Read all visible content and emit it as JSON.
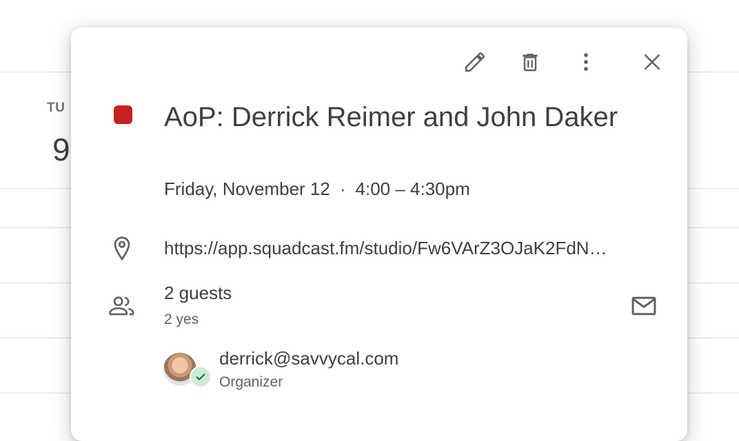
{
  "background": {
    "day_abbrev": "TU",
    "date_number": "9"
  },
  "toolbar": {
    "edit_icon": "pencil-icon",
    "delete_icon": "trash-icon",
    "more_icon": "more-vert-icon",
    "close_icon": "close-icon"
  },
  "event": {
    "color": "#c5221f",
    "title": "AoP: Derrick Reimer and John Daker",
    "date": "Friday, November 12",
    "separator": "·",
    "time": "4:00 – 4:30pm",
    "location": "https://app.squadcast.fm/studio/Fw6VArZ3OJaK2FdN…"
  },
  "guests": {
    "count_label": "2 guests",
    "yes_label": "2 yes",
    "list": [
      {
        "email": "derrick@savvycal.com",
        "role": "Organizer",
        "status": "accepted"
      }
    ]
  }
}
